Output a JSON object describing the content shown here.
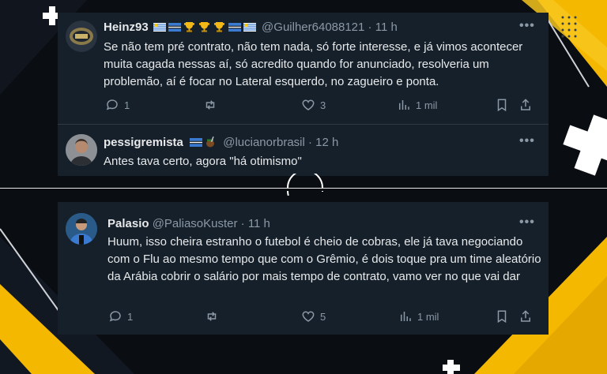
{
  "tweets": [
    {
      "name": "Heinz93",
      "emoji_badges": [
        "uruguay-flag",
        "gremio-flag",
        "trophy",
        "trophy",
        "trophy",
        "gremio-flag",
        "uruguay-flag"
      ],
      "handle": "@Guilher64088121",
      "time": "· 11 h",
      "text": "Se não tem pré contrato, não tem nada, só forte interesse, e já vimos acontecer muita cagada nessas aí, só acredito quando for anunciado, resolveria um problemão, aí é focar no Lateral esquerdo, no zagueiro e ponta.",
      "replies": "1",
      "retweets": "",
      "likes": "3",
      "views": "1 mil"
    },
    {
      "name": "pessigremista",
      "emoji_badges": [
        "gremio-flag",
        "mate-gourd"
      ],
      "handle": "@lucianorbrasil",
      "time": "· 12 h",
      "text": "Antes tava certo, agora \"há otimismo\""
    },
    {
      "name": "Palasio",
      "handle": "@PaliasoKuster",
      "time": "· 11 h",
      "text": "Huum, isso cheira estranho o futebol é cheio de cobras, ele já tava negociando com o Flu ao mesmo tempo que com o Grêmio, é dois toque pra um time aleatório da Arábia cobrir o salário por mais tempo de contrato, vamo ver no que vai dar",
      "replies": "1",
      "retweets": "",
      "likes": "5",
      "views": "1 mil"
    }
  ],
  "more_glyph": "•••",
  "colors": {
    "card_bg": "#15202b",
    "text": "#e7e9ea",
    "muted": "#8b98a5",
    "accent_yellow": "#f5b800",
    "page_bg": "#0a0d12"
  }
}
